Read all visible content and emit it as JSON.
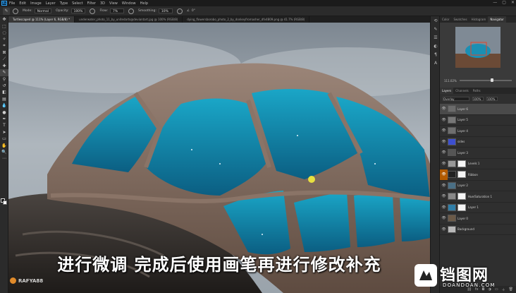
{
  "menubar": {
    "logo": "Ps",
    "items": [
      "File",
      "Edit",
      "Image",
      "Layer",
      "Type",
      "Select",
      "Filter",
      "3D",
      "View",
      "Window",
      "Help"
    ],
    "controls": [
      "—",
      "▢",
      "✕"
    ]
  },
  "options": {
    "mode_label": "Mode:",
    "mode_value": "Normal",
    "opacity_label": "Opacity:",
    "opacity_value": "100%",
    "flow_label": "Flow:",
    "flow_value": "7%",
    "smoothing_label": "Smoothing:",
    "smoothing_value": "10%",
    "angle_value": "0°"
  },
  "tabs": [
    "Turtlescaped @ 111% (Layer 6, RGB/8) *",
    "underwater_photo_11_by_unitedarts@deviantart.jpg @ 100% (RGB/8)",
    "dying_flowersborobo_photo_2_by_donkeyfromasher_dfv4809.png @ 41.7% (RGB/8)"
  ],
  "panels": {
    "top_tabs": [
      "Color",
      "Swatches",
      "Histogram",
      "Navigator"
    ],
    "zoom": "111.02%",
    "layer_tabs": [
      "Layers",
      "Channels",
      "Paths"
    ],
    "blend_mode": "Overlay",
    "opacity_value": "100%",
    "fill_value": "100%",
    "layers": [
      {
        "name": "Layer 6",
        "thumb": "#6b6b6b",
        "mask": false,
        "selected": true
      },
      {
        "name": "Layer 5",
        "thumb": "#777",
        "mask": false,
        "selected": false
      },
      {
        "name": "Layer 4",
        "thumb": "#6f6f6f",
        "mask": false,
        "selected": false
      },
      {
        "name": "sides",
        "thumb": "#3d4fd0",
        "mask": false,
        "selected": false
      },
      {
        "name": "Layer 3",
        "thumb": "#555",
        "mask": false,
        "selected": false
      },
      {
        "name": "Levels 1",
        "thumb": "#999",
        "mask": true,
        "selected": false
      },
      {
        "name": "Ribbon",
        "thumb": "#222",
        "mask": true,
        "selected": false
      },
      {
        "name": "Layer 2",
        "thumb": "#4a6f85",
        "mask": false,
        "selected": false
      },
      {
        "name": "Hue/Saturation 1",
        "thumb": "#888",
        "mask": true,
        "selected": false
      },
      {
        "name": "Layer 1",
        "thumb": "#2f7ea8",
        "mask": true,
        "selected": false
      },
      {
        "name": "Layer 0",
        "thumb": "#6b5a48",
        "mask": false,
        "selected": false
      },
      {
        "name": "Background",
        "thumb": "#b8b8b8",
        "mask": false,
        "selected": false
      }
    ]
  },
  "caption": "进行微调 完成后使用画笔再进行修改补充",
  "watermark": {
    "channel": "RAFYA88",
    "site_name": "铛图网",
    "site_url": "DOANDOAN.COM"
  }
}
